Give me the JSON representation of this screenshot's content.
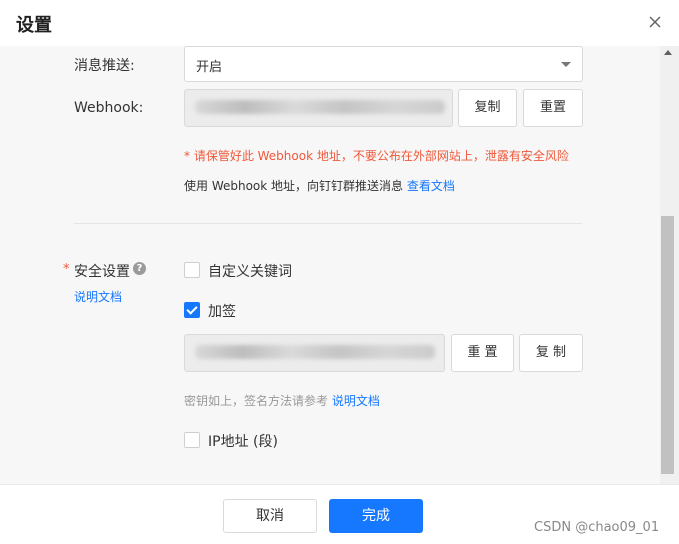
{
  "dialog": {
    "title": "设置",
    "close_icon": "close-icon"
  },
  "push": {
    "label": "消息推送:",
    "selected": "开启"
  },
  "webhook": {
    "label": "Webhook:",
    "copy_label": "复制",
    "reset_label": "重置",
    "warning": "* 请保管好此 Webhook 地址，不要公布在外部网站上，泄露有安全风险",
    "hint": "使用 Webhook 地址，向钉钉群推送消息",
    "doc_link": "查看文档"
  },
  "security": {
    "required_mark": "*",
    "label": "安全设置",
    "help_icon": "question-circle-icon",
    "doc_link": "说明文档",
    "keyword_label": "自定义关键词",
    "keyword_checked": false,
    "sign_label": "加签",
    "sign_checked": true,
    "reset_label": "重 置",
    "copy_label": "复 制",
    "secret_hint": "密钥如上，签名方法请参考",
    "secret_doc_link": "说明文档",
    "ip_label": "IP地址 (段)",
    "ip_checked": false
  },
  "footer": {
    "cancel_label": "取消",
    "ok_label": "完成",
    "watermark": "CSDN @chao09_01"
  }
}
